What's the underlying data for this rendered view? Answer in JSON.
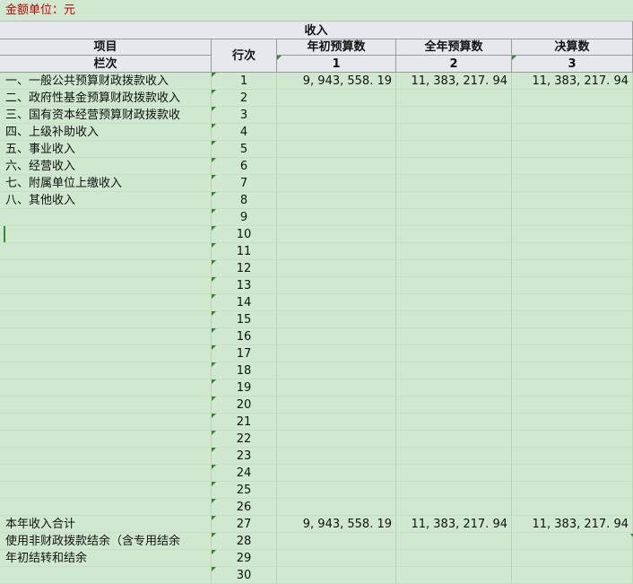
{
  "unit_label": "金额单位：元",
  "header": {
    "income": "收入",
    "item": "项目",
    "column_no": "栏次",
    "row_no": "行次",
    "col1": "年初预算数",
    "col2": "全年预算数",
    "col3": "决算数",
    "col1_no": "1",
    "col2_no": "2",
    "col3_no": "3"
  },
  "rows": [
    {
      "item": "一、一般公共预算财政拨款收入",
      "no": "1",
      "v1": "9, 943, 558. 19",
      "v2": "11, 383, 217. 94",
      "v3": "11, 383, 217. 94"
    },
    {
      "item": "二、政府性基金预算财政拨款收入",
      "no": "2",
      "v1": "",
      "v2": "",
      "v3": ""
    },
    {
      "item": "三、国有资本经营预算财政拨款收",
      "no": "3",
      "v1": "",
      "v2": "",
      "v3": ""
    },
    {
      "item": "四、上级补助收入",
      "no": "4",
      "v1": "",
      "v2": "",
      "v3": ""
    },
    {
      "item": "五、事业收入",
      "no": "5",
      "v1": "",
      "v2": "",
      "v3": ""
    },
    {
      "item": "六、经营收入",
      "no": "6",
      "v1": "",
      "v2": "",
      "v3": ""
    },
    {
      "item": "七、附属单位上缴收入",
      "no": "7",
      "v1": "",
      "v2": "",
      "v3": ""
    },
    {
      "item": "八、其他收入",
      "no": "8",
      "v1": "",
      "v2": "",
      "v3": ""
    },
    {
      "item": "",
      "no": "9",
      "v1": "",
      "v2": "",
      "v3": ""
    },
    {
      "item": "",
      "no": "10",
      "v1": "",
      "v2": "",
      "v3": ""
    },
    {
      "item": "",
      "no": "11",
      "v1": "",
      "v2": "",
      "v3": ""
    },
    {
      "item": "",
      "no": "12",
      "v1": "",
      "v2": "",
      "v3": ""
    },
    {
      "item": "",
      "no": "13",
      "v1": "",
      "v2": "",
      "v3": ""
    },
    {
      "item": "",
      "no": "14",
      "v1": "",
      "v2": "",
      "v3": ""
    },
    {
      "item": "",
      "no": "15",
      "v1": "",
      "v2": "",
      "v3": ""
    },
    {
      "item": "",
      "no": "16",
      "v1": "",
      "v2": "",
      "v3": ""
    },
    {
      "item": "",
      "no": "17",
      "v1": "",
      "v2": "",
      "v3": ""
    },
    {
      "item": "",
      "no": "18",
      "v1": "",
      "v2": "",
      "v3": ""
    },
    {
      "item": "",
      "no": "19",
      "v1": "",
      "v2": "",
      "v3": ""
    },
    {
      "item": "",
      "no": "20",
      "v1": "",
      "v2": "",
      "v3": ""
    },
    {
      "item": "",
      "no": "21",
      "v1": "",
      "v2": "",
      "v3": ""
    },
    {
      "item": "",
      "no": "22",
      "v1": "",
      "v2": "",
      "v3": ""
    },
    {
      "item": "",
      "no": "23",
      "v1": "",
      "v2": "",
      "v3": ""
    },
    {
      "item": "",
      "no": "24",
      "v1": "",
      "v2": "",
      "v3": ""
    },
    {
      "item": "",
      "no": "25",
      "v1": "",
      "v2": "",
      "v3": ""
    },
    {
      "item": "",
      "no": "26",
      "v1": "",
      "v2": "",
      "v3": ""
    },
    {
      "item": "本年收入合计",
      "no": "27",
      "v1": "9, 943, 558. 19",
      "v2": "11, 383, 217. 94",
      "v3": "11, 383, 217. 94"
    },
    {
      "item": "使用非财政拨款结余（含专用结余",
      "no": "28",
      "v1": "",
      "v2": "",
      "v3": ""
    },
    {
      "item": "年初结转和结余",
      "no": "29",
      "v1": "",
      "v2": "",
      "v3": ""
    },
    {
      "item": "",
      "no": "30",
      "v1": "",
      "v2": "",
      "v3": ""
    }
  ]
}
